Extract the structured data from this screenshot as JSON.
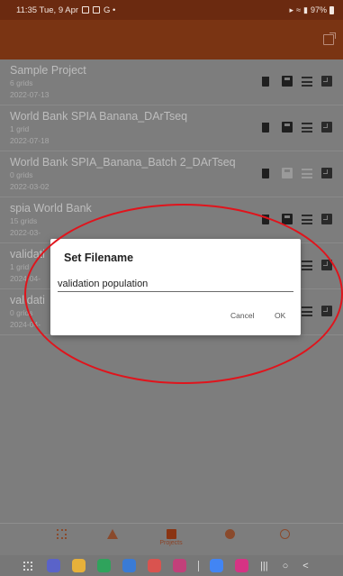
{
  "status_bar": {
    "time_date": "11:35  Tue, 9 Apr",
    "extra": "G  •",
    "battery": "97%"
  },
  "projects": [
    {
      "title": "Sample Project",
      "grids": "6 grids",
      "date": "2022-07-13",
      "save_enabled": true,
      "list_enabled": true
    },
    {
      "title": "World Bank SPIA Banana_DArTseq",
      "grids": "1 grid",
      "date": "2022-07-18",
      "save_enabled": true,
      "list_enabled": true
    },
    {
      "title": "World Bank SPIA_Banana_Batch 2_DArTseq",
      "grids": "0 grids",
      "date": "2022-03-02",
      "save_enabled": false,
      "list_enabled": false
    },
    {
      "title": "spia World Bank",
      "grids": "15 grids",
      "date": "2022-03-",
      "save_enabled": true,
      "list_enabled": true
    },
    {
      "title": "validati",
      "grids": "1 grid",
      "date": "2024-04-",
      "save_enabled": true,
      "list_enabled": true
    },
    {
      "title": "validati",
      "grids": "0 grids",
      "date": "2024-04-",
      "save_enabled": true,
      "list_enabled": true
    }
  ],
  "dialog": {
    "title": "Set Filename",
    "input_value": "validation population",
    "cancel_label": "Cancel",
    "ok_label": "OK"
  },
  "bottom_nav": {
    "projects_label": "Projects"
  },
  "colors": {
    "app_bar": "#7a3413",
    "overlay_bg": "#7d7d7d",
    "annotation": "#e0141c"
  }
}
